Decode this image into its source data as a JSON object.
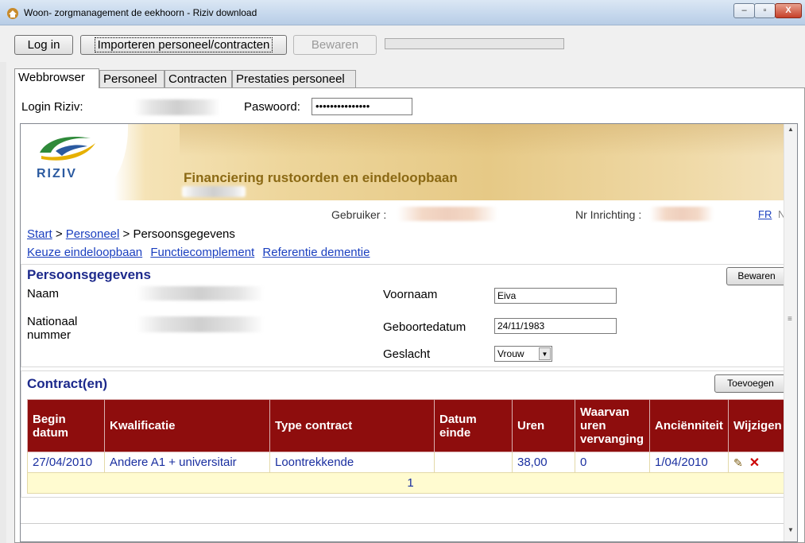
{
  "window": {
    "title": "Woon- zorgmanagement de eekhoorn - Riziv download",
    "controls": {
      "minimize": "–",
      "maximize": "▫",
      "close": "X"
    }
  },
  "toolbar": {
    "login_label": "Log in",
    "import_label": "Importeren personeel/contracten",
    "save_label": "Bewaren"
  },
  "tabs": [
    "Webbrowser",
    "Personeel",
    "Contracten",
    "Prestaties personeel"
  ],
  "login": {
    "user_label": "Login Riziv:",
    "password_label": "Paswoord:",
    "password_value": "•••••••••••••••"
  },
  "site": {
    "logo_text": "RIZIV",
    "banner_title": "Financiering rustoorden en eindeloopbaan",
    "user_label": "Gebruiker :",
    "inrichting_label": "Nr Inrichting :",
    "lang_fr": "FR",
    "lang_nl": "NL",
    "breadcrumb": {
      "start": "Start",
      "sep": ">",
      "personeel": "Personeel",
      "current": "Persoonsgegevens"
    },
    "links": [
      "Keuze eindeloopbaan",
      "Functiecomplement",
      "Referentie dementie"
    ]
  },
  "persoon": {
    "title": "Persoonsgegevens",
    "save_label": "Bewaren",
    "naam_label": "Naam",
    "nationaal_label_1": "Nationaal",
    "nationaal_label_2": "nummer",
    "voornaam_label": "Voornaam",
    "voornaam_value": "Eiva",
    "geboortedatum_label": "Geboortedatum",
    "geboortedatum_value": "24/11/1983",
    "geslacht_label": "Geslacht",
    "geslacht_value": "Vrouw"
  },
  "contracten": {
    "title": "Contract(en)",
    "add_label": "Toevoegen",
    "columns": [
      "Begin datum",
      "Kwalificatie",
      "Type contract",
      "Datum einde",
      "Uren",
      "Waarvan uren vervanging",
      "Anciënniteit",
      "Wijzigen"
    ],
    "rows": [
      [
        "27/04/2010",
        "Andere A1 + universitair",
        "Loontrekkende",
        "",
        "38,00",
        "0",
        "1/04/2010",
        ""
      ]
    ],
    "pager": "1"
  },
  "colors": {
    "table_header": "#8e0d0d",
    "section_title": "#1d2a8c",
    "banner_title": "#8b6914",
    "link": "#1a3fbf"
  }
}
